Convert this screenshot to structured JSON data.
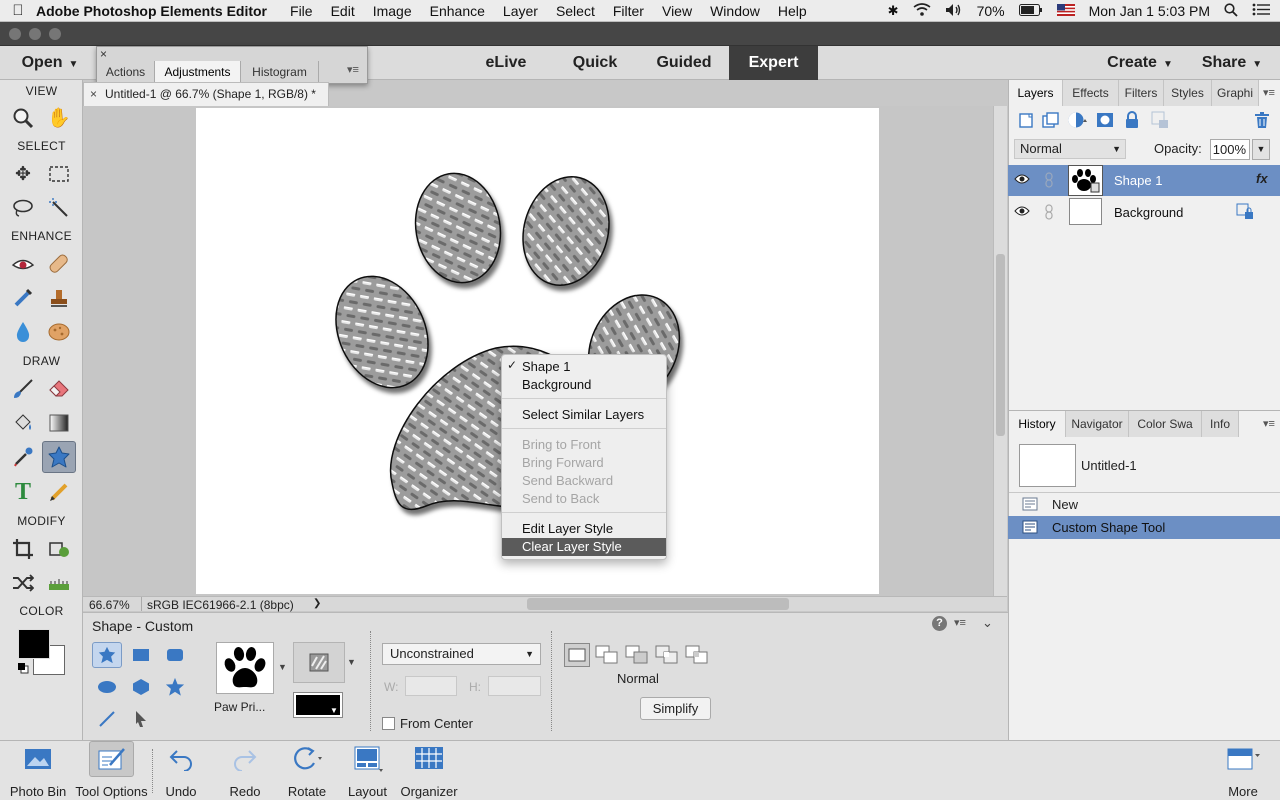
{
  "menubar": {
    "app_name": "Adobe Photoshop Elements Editor",
    "items": [
      "File",
      "Edit",
      "Image",
      "Enhance",
      "Layer",
      "Select",
      "Filter",
      "View",
      "Window",
      "Help"
    ],
    "battery": "70%",
    "clock": "Mon Jan 1  5:03 PM"
  },
  "modebar": {
    "open_label": "Open",
    "modes": [
      "eLive",
      "Quick",
      "Guided",
      "Expert"
    ],
    "active_mode": "Expert",
    "create_label": "Create",
    "share_label": "Share"
  },
  "float_panel": {
    "tabs": [
      "Actions",
      "Adjustments",
      "Histogram"
    ],
    "active": "Adjustments"
  },
  "document": {
    "tab_title": "Untitled-1 @ 66.7% (Shape 1, RGB/8) *",
    "zoom": "66.67%",
    "color_profile": "sRGB IEC61966-2.1 (8bpc)"
  },
  "toolbox": {
    "sections": {
      "view": "VIEW",
      "select": "SELECT",
      "enhance": "ENHANCE",
      "draw": "DRAW",
      "modify": "MODIFY",
      "color": "COLOR"
    },
    "selected_tool": "custom-shape-tool"
  },
  "context_menu": {
    "layers": [
      {
        "label": "Shape 1",
        "checked": true
      },
      {
        "label": "Background",
        "checked": false
      }
    ],
    "select_similar": "Select Similar Layers",
    "arrange": [
      "Bring to Front",
      "Bring Forward",
      "Send Backward",
      "Send to Back"
    ],
    "edit_style": "Edit Layer Style",
    "clear_style": "Clear Layer Style",
    "highlighted": "Clear Layer Style"
  },
  "layers_panel": {
    "tabs": [
      "Layers",
      "Effects",
      "Filters",
      "Styles",
      "Graphi"
    ],
    "active_tab": "Layers",
    "blend_mode": "Normal",
    "opacity_label": "Opacity:",
    "opacity_value": "100%",
    "layers": [
      {
        "name": "Shape 1",
        "selected": true,
        "fx": "fx"
      },
      {
        "name": "Background",
        "selected": false,
        "fx": ""
      }
    ]
  },
  "history_panel": {
    "tabs": [
      "History",
      "Navigator",
      "Color Swa",
      "Info"
    ],
    "active_tab": "History",
    "snapshot": "Untitled-1",
    "steps": [
      {
        "label": "New",
        "selected": false
      },
      {
        "label": "Custom Shape Tool",
        "selected": true
      }
    ]
  },
  "tool_options": {
    "title": "Shape - Custom",
    "shape_label": "Paw Pri...",
    "constraint": "Unconstrained",
    "w_label": "W:",
    "h_label": "H:",
    "from_center_label": "From Center",
    "mode_label": "Normal",
    "simplify_label": "Simplify",
    "help_glyph": "?"
  },
  "bottom_bar": {
    "items": [
      "Photo Bin",
      "Tool Options",
      "Undo",
      "Redo",
      "Rotate",
      "Layout",
      "Organizer"
    ],
    "more_label": "More"
  },
  "colors": {
    "accent": "#6c8fc4",
    "active_mode_bg": "#3d3d3d",
    "foreground": "#000000",
    "background": "#ffffff"
  }
}
